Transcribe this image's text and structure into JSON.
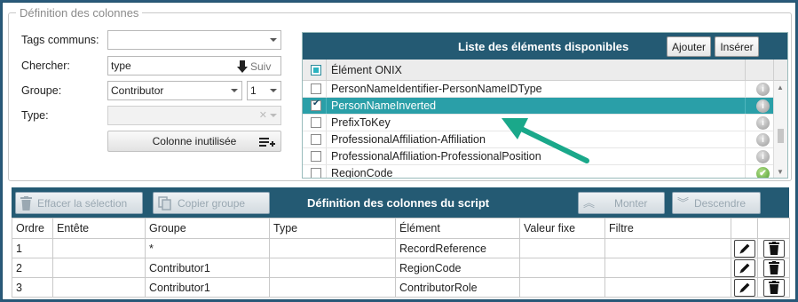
{
  "colonnes": {
    "legend": "Définition des colonnes",
    "tags_label": "Tags communs:",
    "tags_value": "",
    "chercher_label": "Chercher:",
    "chercher_value": "type",
    "suiv_label": "Suiv",
    "groupe_label": "Groupe:",
    "groupe_value": "Contributor",
    "groupe_index": "1",
    "type_label": "Type:",
    "type_value": "",
    "unused_button": "Colonne inutilisée"
  },
  "available": {
    "title": "Liste des éléments disponibles",
    "add_button": "Ajouter",
    "insert_button": "Insérer",
    "column_header": "Élément ONIX",
    "items": [
      {
        "label": "PersonNameIdentifier-PersonNameIDType",
        "checked": false,
        "selected": false,
        "status": "info"
      },
      {
        "label": "PersonNameInverted",
        "checked": true,
        "selected": true,
        "status": "info"
      },
      {
        "label": "PrefixToKey",
        "checked": false,
        "selected": false,
        "status": "info"
      },
      {
        "label": "ProfessionalAffiliation-Affiliation",
        "checked": false,
        "selected": false,
        "status": "info"
      },
      {
        "label": "ProfessionalAffiliation-ProfessionalPosition",
        "checked": false,
        "selected": false,
        "status": "info"
      },
      {
        "label": "RegionCode",
        "checked": false,
        "selected": false,
        "status": "ok"
      }
    ]
  },
  "script": {
    "title": "Définition des colonnes du script",
    "clear_button": "Effacer la sélection",
    "copy_button": "Copier groupe",
    "up_button": "Monter",
    "down_button": "Descendre",
    "headers": [
      "Ordre",
      "Entête",
      "Groupe",
      "Type",
      "Élément",
      "Valeur fixe",
      "Filtre"
    ],
    "rows": [
      {
        "ordre": "1",
        "entete": "",
        "groupe": "*",
        "type": "",
        "element": "RecordReference",
        "valeur": "",
        "filtre": ""
      },
      {
        "ordre": "2",
        "entete": "",
        "groupe": "Contributor1",
        "type": "",
        "element": "RegionCode",
        "valeur": "",
        "filtre": ""
      },
      {
        "ordre": "3",
        "entete": "",
        "groupe": "Contributor1",
        "type": "",
        "element": "ContributorRole",
        "valeur": "",
        "filtre": ""
      }
    ]
  },
  "colors": {
    "header_bg": "#245a73",
    "selected_row": "#2a9fa8",
    "arrow": "#1aa88a"
  }
}
